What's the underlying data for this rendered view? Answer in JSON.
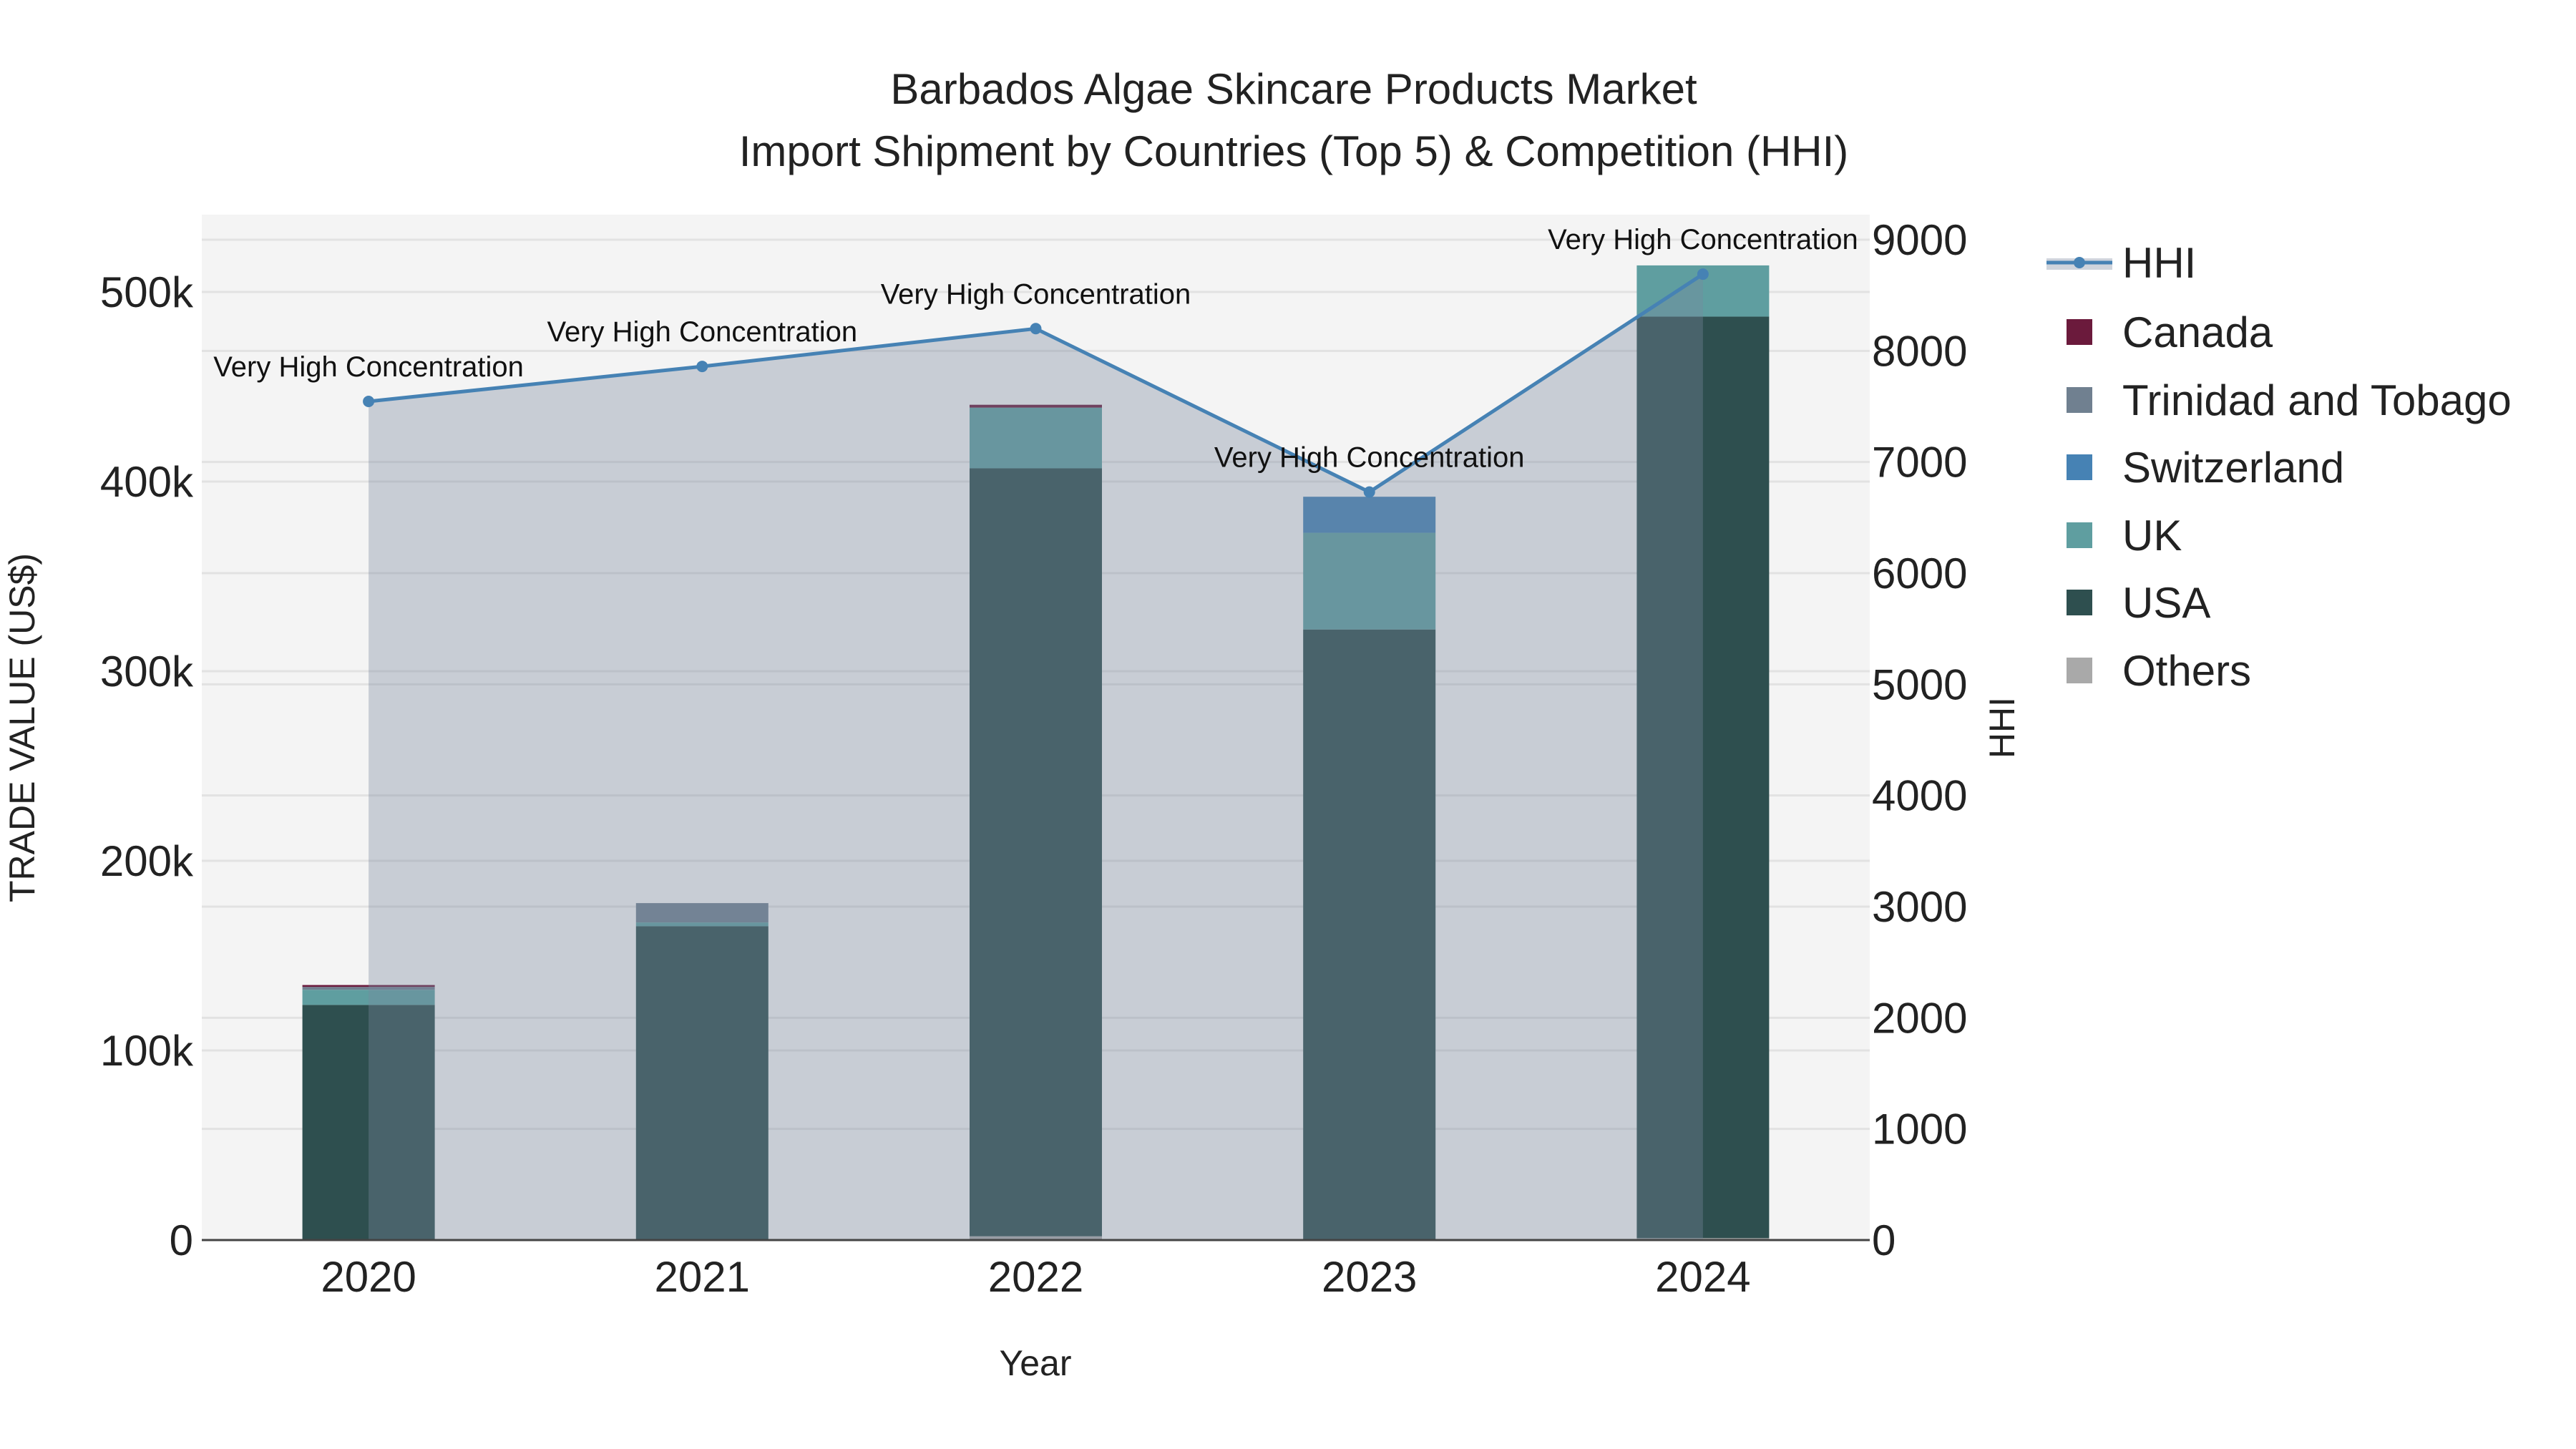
{
  "chart_data": {
    "type": "bar",
    "title": "Barbados Algae Skincare Products Market",
    "subtitle": "Import Shipment by Countries (Top 5) & Competition (HHI)",
    "xlabel": "Year",
    "ylabel": "TRADE VALUE (US$)",
    "y2label": "HHI",
    "categories": [
      "2020",
      "2021",
      "2022",
      "2023",
      "2024"
    ],
    "ylim": [
      0,
      540000
    ],
    "y2lim": [
      0,
      9200
    ],
    "yticks": [
      0,
      100000,
      200000,
      300000,
      400000,
      500000
    ],
    "ytick_labels": [
      "0",
      "100k",
      "200k",
      "300k",
      "400k",
      "500k"
    ],
    "y2ticks": [
      0,
      1000,
      2000,
      3000,
      4000,
      5000,
      6000,
      7000,
      8000,
      9000
    ],
    "y2tick_labels": [
      "0",
      "1000",
      "2000",
      "3000",
      "4000",
      "5000",
      "6000",
      "7000",
      "8000",
      "9000"
    ],
    "grid": true,
    "legend_position": "right",
    "series": [
      {
        "name": "Others",
        "color": "#a9a9a9",
        "values": [
          0,
          0,
          2000,
          0,
          1000
        ]
      },
      {
        "name": "USA",
        "color": "#2e4f4f",
        "values": [
          124000,
          165500,
          405000,
          322000,
          486000
        ]
      },
      {
        "name": "UK",
        "color": "#5f9ea0",
        "values": [
          8000,
          2000,
          32000,
          51000,
          27000
        ]
      },
      {
        "name": "Switzerland",
        "color": "#4682b4",
        "values": [
          0,
          0,
          0,
          19000,
          0
        ]
      },
      {
        "name": "Trinidad and Tobago",
        "color": "#708090",
        "values": [
          1500,
          10200,
          0,
          0,
          0
        ]
      },
      {
        "name": "Canada",
        "color": "#6b1a3c",
        "values": [
          1000,
          0,
          1500,
          0,
          0
        ]
      }
    ],
    "hhi": {
      "name": "HHI",
      "color": "#4682b4",
      "values": [
        7545,
        7860,
        8200,
        6730,
        8690
      ],
      "annotations": [
        "Very High Concentration",
        "Very High Concentration",
        "Very High Concentration",
        "Very High Concentration",
        "Very High Concentration"
      ]
    },
    "legend_order": [
      "HHI",
      "Canada",
      "Trinidad and Tobago",
      "Switzerland",
      "UK",
      "USA",
      "Others"
    ]
  }
}
